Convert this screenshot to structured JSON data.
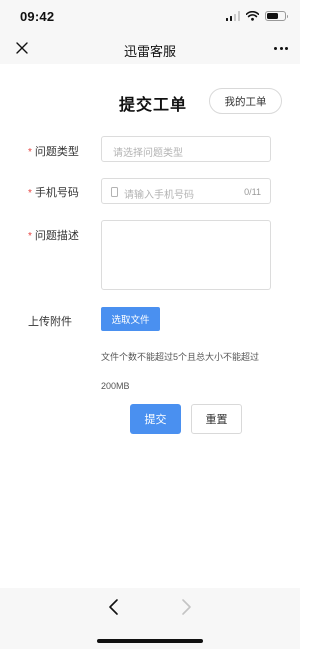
{
  "status_bar": {
    "time": "09:42"
  },
  "nav": {
    "title": "迅雷客服"
  },
  "page": {
    "title": "提交工单",
    "my_tickets": "我的工单"
  },
  "form": {
    "type": {
      "label": "问题类型",
      "placeholder": "请选择问题类型"
    },
    "phone": {
      "label": "手机号码",
      "placeholder": "请输入手机号码",
      "counter": "0/11"
    },
    "desc": {
      "label": "问题描述",
      "value": ""
    },
    "attach": {
      "label": "上传附件",
      "button": "选取文件",
      "hint": "文件个数不能超过5个且总大小不能超过200MB"
    },
    "required_mark": "*"
  },
  "actions": {
    "submit": "提交",
    "reset": "重置"
  },
  "colors": {
    "primary": "#4a90f0",
    "required": "#e64340"
  }
}
